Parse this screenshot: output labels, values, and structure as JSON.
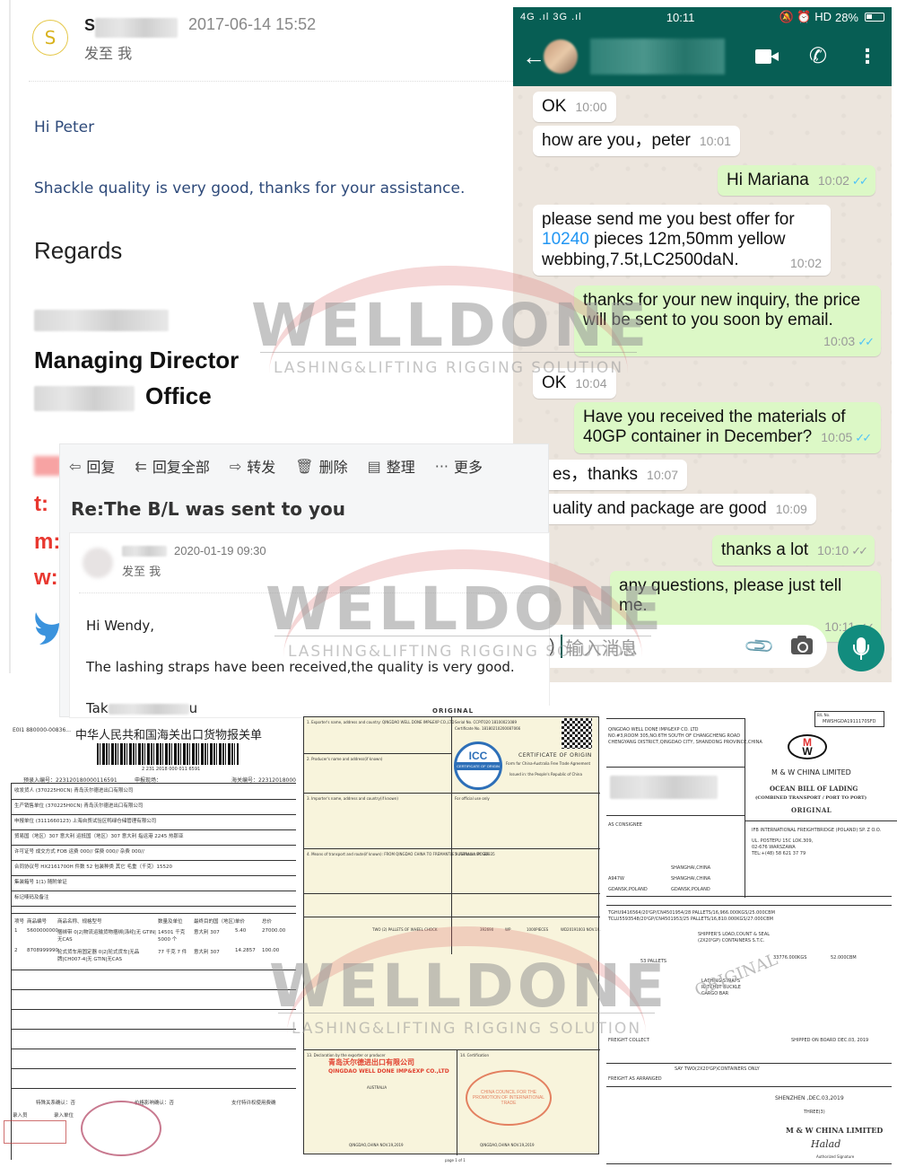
{
  "email1": {
    "avatar_letter": "S",
    "sender_initial": "S",
    "date": "2017-06-14 15:52",
    "sent_to": "发至 我",
    "greeting": "Hi Peter",
    "body": "Shackle quality is very good, thanks for your assistance.",
    "closing": "Regards",
    "signature_title": "Managing Director",
    "signature_office": "Office",
    "contact_labels": [
      "t:",
      "m:",
      "w:"
    ],
    "social_icon": "twitter-bird-icon"
  },
  "whatsapp": {
    "status_bar": {
      "signal": "4G .ıl 3G .ıl",
      "time": "10:11",
      "icons": "🔕 ⏰ HD",
      "battery": "28%"
    },
    "messages": [
      {
        "dir": "in",
        "text": "OK",
        "time": "10:00"
      },
      {
        "dir": "in",
        "text": "how are you，peter",
        "time": "10:01"
      },
      {
        "dir": "out",
        "text": "Hi Mariana",
        "time": "10:02",
        "ticks": "read"
      },
      {
        "dir": "in",
        "text_pre": "please send me you best   offer for",
        "link": "10240",
        "text_post": " pieces 12m,50mm yellow",
        "text_line3": "webbing,7.5t,LC2500daN.",
        "time": "10:02"
      },
      {
        "dir": "out",
        "text": "thanks for your new inquiry, the price",
        "text2": "will be sent to you soon by email.",
        "time": "10:03",
        "ticks": "read"
      },
      {
        "dir": "in",
        "text": "OK",
        "time": "10:04"
      },
      {
        "dir": "out",
        "text": "Have you received the materials of",
        "text2": "40GP container in December?",
        "time": "10:05",
        "ticks": "read"
      },
      {
        "dir": "in",
        "text": "es，thanks",
        "time": "10:07"
      },
      {
        "dir": "in",
        "text": "uality and package are good",
        "time": "10:09"
      },
      {
        "dir": "out",
        "text": "thanks a lot",
        "time": "10:10",
        "ticks": "delivered"
      },
      {
        "dir": "out",
        "text": "any questions, please just tell me.",
        "time": "10:11",
        "ticks": "delivered"
      }
    ],
    "input_placeholder": "输入消息",
    "input_prefix": ")",
    "tick_glyph": "✓✓"
  },
  "email2": {
    "toolbar": [
      {
        "icon": "reply-icon",
        "glyph": "⇦",
        "label": "回复"
      },
      {
        "icon": "reply-all-icon",
        "glyph": "⇇",
        "label": "回复全部"
      },
      {
        "icon": "forward-icon",
        "glyph": "⇨",
        "label": "转发"
      },
      {
        "icon": "trash-icon",
        "glyph": "🗑",
        "label": "删除"
      },
      {
        "icon": "archive-icon",
        "glyph": "▤",
        "label": "整理"
      },
      {
        "icon": "more-icon",
        "glyph": "···",
        "label": "更多"
      }
    ],
    "subject": "Re:The B/L was sent to you",
    "date": "2020-01-19 09:30",
    "sent_to": "发至 我",
    "greeting": "Hi Wendy,",
    "body": "The lashing straps have been received,the quality is very good.",
    "sign_prefix": "Tak",
    "sign_suffix": "u"
  },
  "documents": {
    "customs": {
      "ref": "E0I1 880000-00836...",
      "title": "中华人民共和国海关出口货物报关单",
      "barcode_number": "2 231 2018 000 011 6591",
      "entry_no": "预录入编号：223120180000116591",
      "declare_port": "申报现场：",
      "customs_no": "海关编号：22312018000",
      "rows": [
        "收发货人  (370225H0CN)  青岛沃尔德进出口有限公司",
        "生产销售单位  (370225H0CN)  青岛沃尔德进出口有限公司",
        "申报单位  (3111660123)  上海自贸试验区鸭绿仓储管理有限公司",
        "贸易国（地区）307 意大利   运抵国（地区）307 意大利   指运港 2245 热那亚",
        "许可证号   成交方式 FOB   运费 000//   保费 000//   杂费 000//",
        "合同协议号 HX2161700H   件数 52   包装种类 其它   毛重（千克）15520",
        "集装箱号 1(1)   随附单证",
        "标记唛码及备注"
      ],
      "items_header": [
        "项号",
        "商品编号",
        "商品名称、规格型号",
        "数量及单位",
        "最终目的国（地区）",
        "单价",
        "总价"
      ],
      "items": [
        [
          "1",
          "5600000000",
          "捆绑带 0|2|物流运输货物捆绑|涤纶|无 GTIN|无CAS",
          "14501 千克 5000 个",
          "意大利 307",
          "5.40",
          "27000.00"
        ],
        [
          "2",
          "8708999990",
          "轮式货车用固定器 0|2|轮式货车|无品牌|CH007-4|无 GTIN|无CAS",
          "77 千克 7 件",
          "意大利 307",
          "14.2857",
          "100.00"
        ]
      ],
      "footer": [
        "特殊关系确认：否",
        "价格影响确认：否",
        "支付特许权使用费确"
      ],
      "footer2": [
        "录入员",
        "录入单位"
      ]
    },
    "certificate_of_origin": {
      "heading": "ORIGINAL",
      "exporter": "1. Exporter's name, address and country: QINGDAO WELL DONE IMP&EXP CO.,LTD",
      "serial_no": "Serial No.  CCPIT020 18100021089",
      "certificate_no": "Certificate No.  18180210200087066",
      "title": "CERTIFICATE OF ORIGIN",
      "subtitle": "Form for China-Australia Free Trade Agreement",
      "issued_in": "Issued in: the People's Republic of China",
      "icc_label": "ICC",
      "icc_band": "CERTIFICATE OF ORIGIN",
      "producer": "2. Producer's name and address(if known)",
      "importer": "3. Importer's name, address and country(if known)",
      "official_use": "For official use only",
      "transport": "4. Means of transport and route(if known): FROM QINGDAO CHINA TO FREMANTLE AUSTRALIA BY SEA",
      "remarks": "5. Remarks: PO 36335",
      "goods": "TWO (2) PALLETS OF WHEEL CHOCK",
      "hs_code": "392690",
      "origin_criterion": "WP",
      "quantity": "1000PIECES",
      "invoice": "WD20191003 NOV.19.2019",
      "declaration_title": "13. Declaration by the exporter or producer",
      "importing_party": "AUSTRALIA",
      "exporter_chop_cn": "青岛沃尔德进出口有限公司",
      "exporter_chop_en": "QINGDAO WELL DONE IMP&EXP CO.,LTD",
      "declaration_place": "QINGDAO,CHINA   NOV.19,2019",
      "certification_title": "14. Certification",
      "stamp_text": "CHINA COUNCIL FOR THE PROMOTION OF INTERNATIONAL TRADE",
      "certification_place": "QINGDAO,CHINA  NOV.19,2019",
      "page": "page 1 of 1"
    },
    "bill_of_lading": {
      "bl_no_label": "B/L No.",
      "bl_no": "MWSHGDA1911170SFD",
      "shipper": "QINGDAO WELL DONE IMP&EXP CO. LTD",
      "shipper_addr1": "NO.#3,ROOM 305,NO.6TH SOUTH OF CHANGCHENG ROAD",
      "shipper_addr2": "CHENGYANG DISTRICT,QINGDAO CITY, SHANDONG PROVINCE,CHINA",
      "logo_m": "M",
      "logo_w": "W",
      "company": "M & W CHINA LIMITED",
      "doc_title": "OCEAN BILL OF LADING",
      "doc_subtitle": "(COMBINED TRANSPORT / PORT TO PORT)",
      "original": "ORIGINAL",
      "notify": "AS CONSIGNEE",
      "delivery_agent": "IFB INTERNATIONAL FREIGHTBRIDGE (POLAND) SP. Z O.O.",
      "delivery_addr": "UL. POSTEPU 15C LOK.309,",
      "delivery_city": "02-676 WARSZAWA",
      "delivery_tel": "TEL:+(48) 58 621 37 79",
      "vessel": "A947W",
      "place_of_receipt": "SHANGHAI,CHINA",
      "port_of_loading": "SHANGHAI,CHINA",
      "port_of_discharge": "GDANSK,POLAND",
      "place_of_delivery": "GDANSK,POLAND",
      "container1": "TGHU9416564/20'GP/CN4501954/28 PALLETS/16,966.000KGS/25.000CBM",
      "container2": "TCLU5593548/20'GP/CN4501953/25 PALLETS/16,810.000KGS/27.000CBM",
      "stc": "SHIPPER'S LOAD,COUNT & SEAL",
      "stc2": "(2X20'GP) CONTAINERS S.T.C.",
      "packages": "53 PALLETS",
      "gross_weight": "33776.000KGS",
      "measurement": "52.000CBM",
      "goods": [
        "LASHING STRAPS",
        "RATCHET BUCKLE",
        "CARGO BAR"
      ],
      "diag_stamp": "ORIGINAL",
      "freight": "FREIGHT COLLECT",
      "shipped_on_board": "SHIPPED ON BOARD DEC.03, 2019",
      "say_total": "SAY TWO(2X20'GP)CONTAINERS ONLY",
      "freight_arrange": "FREIGHT AS ARRANGED",
      "place_date_issue": "SHENZHEN ,DEC.03,2019",
      "original_bls": "THREE(3)",
      "signed_for": "M & W CHINA LIMITED",
      "signature": "Halad",
      "authorized": "Authorized Signature"
    }
  },
  "watermark": {
    "brand": "WELLDONE",
    "tagline": "LASHING&LIFTING RIGGING SOLUTION",
    "arc_color": "#dc6e6e"
  },
  "colors": {
    "whatsapp_green": "#075e54",
    "whatsapp_teal": "#128c7e",
    "outgoing_bubble": "#dcf8c6",
    "chat_bg": "#ece5dd",
    "read_tick": "#4fc3f7",
    "email_body_blue": "#2e4a7a",
    "signature_red": "#e8372f",
    "coo_paper": "#f8f4dc"
  }
}
